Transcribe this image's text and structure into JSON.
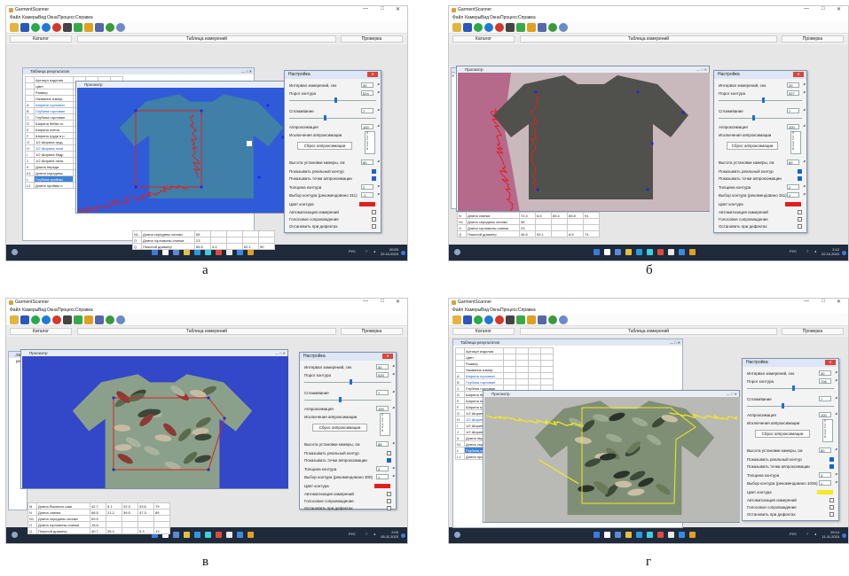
{
  "app": {
    "title": "GarmentScanner",
    "menu": [
      "Файл",
      "Камеры",
      "Вид",
      "Окна",
      "Процесс",
      "Справка"
    ],
    "tabs": [
      "Каталог",
      "Таблица измерений",
      "Проверка"
    ]
  },
  "table_window_title": "Таблица результатов",
  "preview_title": "Просмотр",
  "settings": {
    "title": "Настройка",
    "interval_label": "Интервал измерений, сек",
    "threshold_label": "Порог контура",
    "smoothing_label": "Сглаживание",
    "approx_label": "Аппроксимация",
    "approx_exclusions_label": "Исключения аппроксимации",
    "reset_button": "Сброс аппроксимации",
    "camera_height_label": "Высота установки камеры, см",
    "show_real_contour": "Показывать реальный контур",
    "show_approx_points": "Показывать точки аппроксимации",
    "contour_thickness": "Толщина контура",
    "contour_choice": "Выбор контура (рекомендовано 311)",
    "contour_color": "Цвет контура",
    "auto_measure": "Автоматизация измерений",
    "voice_support": "Голосовое сопровождение",
    "stop_on_defects": "Остановить при дефектах",
    "list_digits": [
      "0",
      "1",
      "2",
      "3",
      "4",
      "5"
    ]
  },
  "table_rows": [
    {
      "code": "",
      "name": "Артикул изделия"
    },
    {
      "code": "",
      "name": "Цвет"
    },
    {
      "code": "",
      "name": "Размер"
    },
    {
      "code": "",
      "name": "Название измер."
    },
    {
      "code": "A",
      "name": "Ширина горловин"
    },
    {
      "code": "B",
      "name": "Глубина горловин"
    },
    {
      "code": "C",
      "name": "Глубина горловин"
    },
    {
      "code": "D",
      "name": "Ширина бейки го"
    },
    {
      "code": "E",
      "name": "Ширина плеча"
    },
    {
      "code": "F",
      "name": "Ширина груди в р"
    },
    {
      "code": "G",
      "name": "1/2 Ширина груд"
    },
    {
      "code": "H",
      "name": "1/2 Ширина тали"
    },
    {
      "code": "I",
      "name": "1/2 Ширина бедр"
    },
    {
      "code": "J",
      "name": "1/2 Ширина низа"
    },
    {
      "code": "K",
      "name": "Длина переда"
    },
    {
      "code": "K1",
      "name": "Длина середины"
    },
    {
      "code": "L",
      "name": "Глубина проймы"
    },
    {
      "code": "L1",
      "name": "Длина проймы п"
    }
  ],
  "bottom_rows": [
    {
      "code": "M",
      "name": "Длина бокового шва",
      "vals": [
        "47.9",
        "30.1",
        "7.2",
        "40.7",
        "65"
      ]
    },
    {
      "code": "N",
      "name": "Длина спинки",
      "vals": [
        "72.4",
        "6.6",
        "65.4",
        "65.8",
        "91"
      ]
    },
    {
      "code": "N1",
      "name": "Длина середины спинки",
      "vals": [
        "55",
        "",
        "",
        "",
        ""
      ]
    },
    {
      "code": "O",
      "name": "Длина горловины спинки",
      "vals": [
        "23",
        "",
        "",
        "",
        ""
      ]
    },
    {
      "code": "Q",
      "name": "Поясной диаметр",
      "vals": [
        "46.5",
        "53.1",
        "",
        "6.6",
        "74"
      ]
    }
  ],
  "bottom_rows_a": [
    {
      "code": "N1",
      "name": "Длина середины спинки",
      "vals": [
        "65",
        "",
        "",
        "",
        ""
      ]
    },
    {
      "code": "O",
      "name": "Длина горловины спинки",
      "vals": [
        "23",
        "",
        "",
        "",
        ""
      ]
    },
    {
      "code": "Q",
      "name": "Поясной диаметр",
      "vals": [
        "66.5",
        "4.4",
        "",
        "62.1",
        "90"
      ]
    }
  ],
  "bottom_rows_v": [
    {
      "code": "M",
      "name": "Длина бокового шва",
      "vals": [
        "42.7",
        "5.1",
        "22.3",
        "33.6",
        "79"
      ]
    },
    {
      "code": "N",
      "name": "Длина спинки",
      "vals": [
        "68.5",
        "21.2",
        "39.5",
        "47.3",
        "89"
      ]
    },
    {
      "code": "N1",
      "name": "Длина середины спинки",
      "vals": [
        "69.9",
        "",
        "",
        "",
        ""
      ]
    },
    {
      "code": "O",
      "name": "Длина горловины спинки",
      "vals": [
        "18.6",
        "",
        "",
        "",
        ""
      ]
    },
    {
      "code": "Q",
      "name": "Поясной диаметр",
      "vals": [
        "40.7",
        "35.4",
        "",
        "5.3",
        "13"
      ]
    }
  ],
  "panels": {
    "a": {
      "label": "а",
      "interval": "30",
      "threshold": "524",
      "smoothing": "7",
      "approx": "100",
      "camera_height": "80",
      "thickness": "2",
      "choice": "-1",
      "real_checked": true,
      "points_checked": true,
      "clock_time": "20:53",
      "clock_date": "22.10.2023"
    },
    "b": {
      "label": "б",
      "interval": "30",
      "threshold": "527",
      "smoothing": "7",
      "approx": "100",
      "camera_height": "80",
      "thickness": "2",
      "choice": "1",
      "real_checked": true,
      "points_checked": true,
      "clock_time": "2:12",
      "clock_date": "22.10.2023"
    },
    "v": {
      "label": "в",
      "interval": "30",
      "threshold": "525",
      "smoothing": "7",
      "approx": "100",
      "camera_height": "85",
      "thickness": "2",
      "choice": "1",
      "real_checked": false,
      "points_checked": true,
      "choice_label": "Выбор контура (рекомендовано 300)",
      "clock_time": "2:03",
      "clock_date": "05.11.2023"
    },
    "g": {
      "label": "г",
      "interval": "30",
      "threshold": "706",
      "smoothing": "7",
      "approx": "100",
      "camera_height": "80",
      "thickness": "3",
      "choice": "1",
      "real_checked": true,
      "points_checked": true,
      "choice_label": "Выбор контура (рекомендовано 1026)",
      "clock_time": "19:14",
      "clock_date": "11.11.2023"
    }
  },
  "tray_lang": "РУС",
  "colors": {
    "contour_red": "#e0201e",
    "contour_yellow": "#f2ea1c",
    "point_blue": "#1a2fd6",
    "bg_blue": "#2f5bd8",
    "bg_gray": "#b9b9b6"
  }
}
